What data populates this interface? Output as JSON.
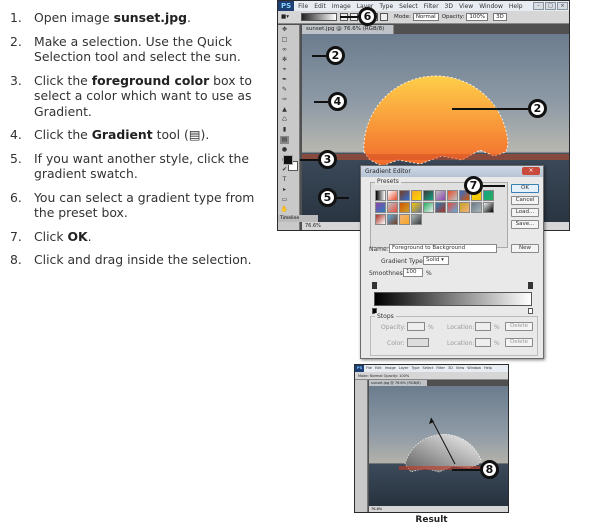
{
  "steps": [
    {
      "num": "1.",
      "pre": "Open image ",
      "bold": "sunset.jpg",
      "post": "."
    },
    {
      "num": "2.",
      "pre": "Make a selection. Use the Quick Selection tool and select the sun.",
      "bold": "",
      "post": ""
    },
    {
      "num": "3.",
      "pre": "Click the ",
      "bold": "foreground color",
      "post": " box to select a color which want to use as Gradient."
    },
    {
      "num": "4.",
      "pre": "Click the ",
      "bold": "Gradient",
      "post": " tool (▤)."
    },
    {
      "num": "5.",
      "pre": "If you want another style,  click the gradient swatch.",
      "bold": "",
      "post": ""
    },
    {
      "num": "6.",
      "pre": "You can select a gradient type from the preset box.",
      "bold": "",
      "post": ""
    },
    {
      "num": "7.",
      "pre": "Click ",
      "bold": "OK",
      "post": "."
    },
    {
      "num": "8.",
      "pre": "Click and drag inside the selection.",
      "bold": "",
      "post": ""
    }
  ],
  "ps": {
    "logo": "PS",
    "menu": [
      "File",
      "Edit",
      "Image",
      "Layer",
      "Type",
      "Select",
      "Filter",
      "3D",
      "View",
      "Window",
      "Help"
    ],
    "options": {
      "mode_label": "Mode:",
      "mode_value": "Normal",
      "opacity_label": "Opacity:",
      "opacity_value": "100%",
      "extra": "3D"
    },
    "doc_tab": "sunset.jpg @ 76.6% (RGB/8)",
    "zoom": "76.6%",
    "timeline": "Timeline"
  },
  "callouts": {
    "c2": "2",
    "c3": "3",
    "c4": "4",
    "c5": "5",
    "c6": "6",
    "c7": "7",
    "c8": "8"
  },
  "dialog": {
    "title": "Gradient Editor",
    "presets_label": "Presets",
    "buttons": {
      "ok": "OK",
      "cancel": "Cancel",
      "load": "Load...",
      "save": "Save...",
      "new": "New"
    },
    "name_label": "Name:",
    "name_value": "Foreground to Background",
    "type_label": "Gradient Type:",
    "type_value": "Solid",
    "smooth_label": "Smoothness:",
    "smooth_value": "100",
    "smooth_unit": "%",
    "stops_label": "Stops",
    "opacity_label": "Opacity:",
    "location_label": "Location:",
    "color_label": "Color:",
    "percent": "%",
    "delete_label": "Delete"
  },
  "result_label": "Result",
  "swatch_colors": [
    "#000000",
    "#ffffff",
    "#7a3c1e",
    "#f5a623",
    "#3b3b3b",
    "#c0c0c0",
    "#e84d2c",
    "#2e6fd8",
    "#ffd800",
    "#16a085",
    "#8e44ad",
    "#bdc3c7",
    "#d35400",
    "#f1c40f",
    "#27ae60",
    "#2980b9",
    "#e74c3c",
    "#c9a227",
    "#6c7a89",
    "#ecf0f1",
    "#a93226",
    "#5dade2",
    "#f0b27a",
    "#aab7b8"
  ],
  "colors": {
    "sun": "#f26a2c",
    "sun_top": "#ffcf4a",
    "callout_border": "#111111",
    "canvas_bg": "#505050"
  }
}
